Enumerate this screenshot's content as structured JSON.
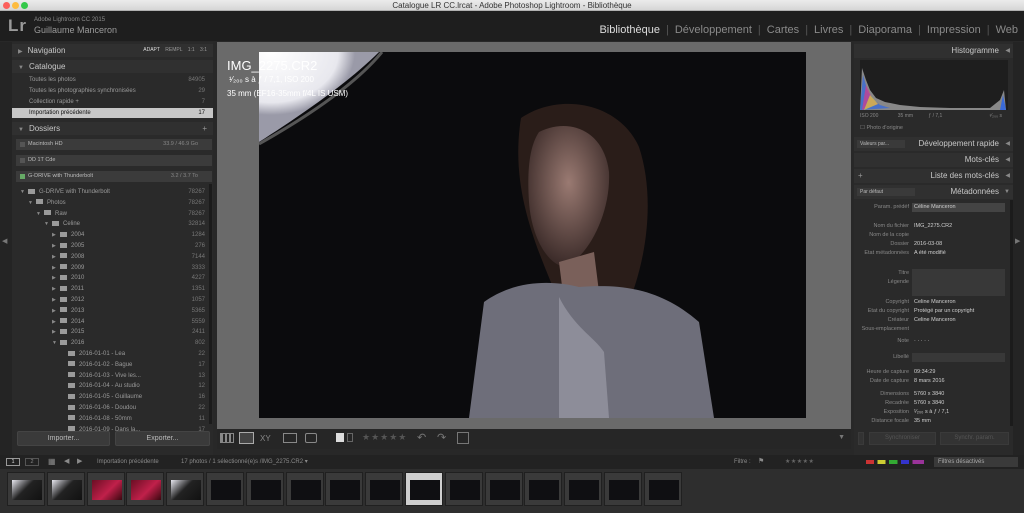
{
  "window": {
    "title": "Catalogue LR CC.lrcat - Adobe Photoshop Lightroom - Bibliothèque"
  },
  "identity": {
    "logo": "Lr",
    "catalog": "Adobe Lightroom CC 2015",
    "user": "Guillaume Manceron"
  },
  "modules": [
    "Bibliothèque",
    "Développement",
    "Cartes",
    "Livres",
    "Diaporama",
    "Impression",
    "Web"
  ],
  "left": {
    "navigator": {
      "title": "Navigation",
      "modes": [
        "ADAPT",
        "REMPL",
        "1:1",
        "3:1"
      ]
    },
    "catalog": {
      "title": "Catalogue",
      "items": [
        {
          "label": "Toutes les photos",
          "count": "84905"
        },
        {
          "label": "Toutes les photographies synchronisées",
          "count": "29"
        },
        {
          "label": "Collection rapide +",
          "count": "7"
        },
        {
          "label": "Importation précédente",
          "count": "17"
        }
      ]
    },
    "folders": {
      "title": "Dossiers",
      "add": "+",
      "volumes": [
        {
          "label": "Macintosh HD",
          "count": "33.9 / 46.9 Go"
        },
        {
          "label": "DD 1T Cde",
          "count": ""
        },
        {
          "label": "G-DRIVE with Thunderbolt",
          "count": "3.2 / 3.7 To"
        }
      ],
      "tree": [
        {
          "label": "G-DRIVE with Thunderbolt",
          "count": "78267"
        },
        {
          "label": "Photos",
          "count": "78267"
        },
        {
          "label": "Raw",
          "count": "78267"
        },
        {
          "label": "Celine",
          "count": "32814"
        },
        {
          "label": "2004",
          "count": "1284"
        },
        {
          "label": "2005",
          "count": "276"
        },
        {
          "label": "2008",
          "count": "7144"
        },
        {
          "label": "2009",
          "count": "3333"
        },
        {
          "label": "2010",
          "count": "4227"
        },
        {
          "label": "2011",
          "count": "1351"
        },
        {
          "label": "2012",
          "count": "1057"
        },
        {
          "label": "2013",
          "count": "5365"
        },
        {
          "label": "2014",
          "count": "5559"
        },
        {
          "label": "2015",
          "count": "2411"
        },
        {
          "label": "2016",
          "count": "802"
        },
        {
          "label": "2016-01-01 - Lea",
          "count": "22"
        },
        {
          "label": "2016-01-02 - Bague",
          "count": "17"
        },
        {
          "label": "2016-01-03 - Vive les...",
          "count": "13"
        },
        {
          "label": "2016-01-04 - Au studio",
          "count": "12"
        },
        {
          "label": "2016-01-05 - Guillaume",
          "count": "16"
        },
        {
          "label": "2016-01-06 - Doudou",
          "count": "22"
        },
        {
          "label": "2016-01-08 - 50mm",
          "count": "11"
        },
        {
          "label": "2016-01-09 - Dans la...",
          "count": "17"
        }
      ]
    },
    "import_label": "Importer...",
    "export_label": "Exporter..."
  },
  "photo": {
    "filename": "IMG_2275.CR2",
    "exposure": "¹⁄₂₀₀ s à ƒ / 7,1, ISO 200",
    "lens": "35 mm (EF16-35mm f/4L IS USM)"
  },
  "right": {
    "histogram": {
      "title": "Histogramme",
      "iso": "ISO 200",
      "focal": "35 mm",
      "aperture": "ƒ / 7,1",
      "shutter": "¹⁄₂₀₀ s",
      "original": "Photo d'origine"
    },
    "quick_develop": {
      "preset": "Valeurs par...",
      "title": "Développement rapide"
    },
    "keywords": {
      "title": "Mots-clés"
    },
    "keyword_list": {
      "title": "Liste des mots-clés"
    },
    "metadata": {
      "preset": "Par défaut",
      "title": "Métadonnées",
      "param_label": "Param. prédéf",
      "param_value": "Céline Manceron",
      "fields": [
        {
          "label": "Nom du fichier",
          "value": "IMG_2275.CR2"
        },
        {
          "label": "Nom de la copie",
          "value": ""
        },
        {
          "label": "Dossier",
          "value": "2016-03-08"
        },
        {
          "label": "Etat métadonnées",
          "value": "A été modifié"
        },
        {
          "label": "Titre",
          "value": ""
        },
        {
          "label": "Légende",
          "value": ""
        },
        {
          "label": "Copyright",
          "value": "Celine Manceron"
        },
        {
          "label": "Etat du copyright",
          "value": "Protégé par un copyright"
        },
        {
          "label": "Créateur",
          "value": "Celine Manceron"
        },
        {
          "label": "Sous-emplacement",
          "value": ""
        },
        {
          "label": "Note",
          "value": "· · · · ·"
        },
        {
          "label": "Libellé",
          "value": ""
        },
        {
          "label": "Heure de capture",
          "value": "09:34:29"
        },
        {
          "label": "Date de capture",
          "value": "8 mars 2016"
        },
        {
          "label": "Dimensions",
          "value": "5760 x 3840"
        },
        {
          "label": "Recadrée",
          "value": "5760 x 3840"
        },
        {
          "label": "Exposition",
          "value": "¹⁄₂₀₀ s à ƒ / 7,1"
        },
        {
          "label": "Distance focale",
          "value": "35 mm"
        }
      ]
    },
    "sync_meta": "Synchroniser",
    "sync_params": "Synchr. param."
  },
  "filmstrip_bar": {
    "pages": [
      "1",
      "2"
    ],
    "source": "Importation précédente",
    "info": "17 photos / 1 sélectionné(e)s /IMG_2275.CR2 ▾",
    "filter_label": "Filtre :",
    "filter_value": "Filtres désactivés"
  },
  "filmstrip": {
    "count": 17,
    "selected_index": 10
  }
}
